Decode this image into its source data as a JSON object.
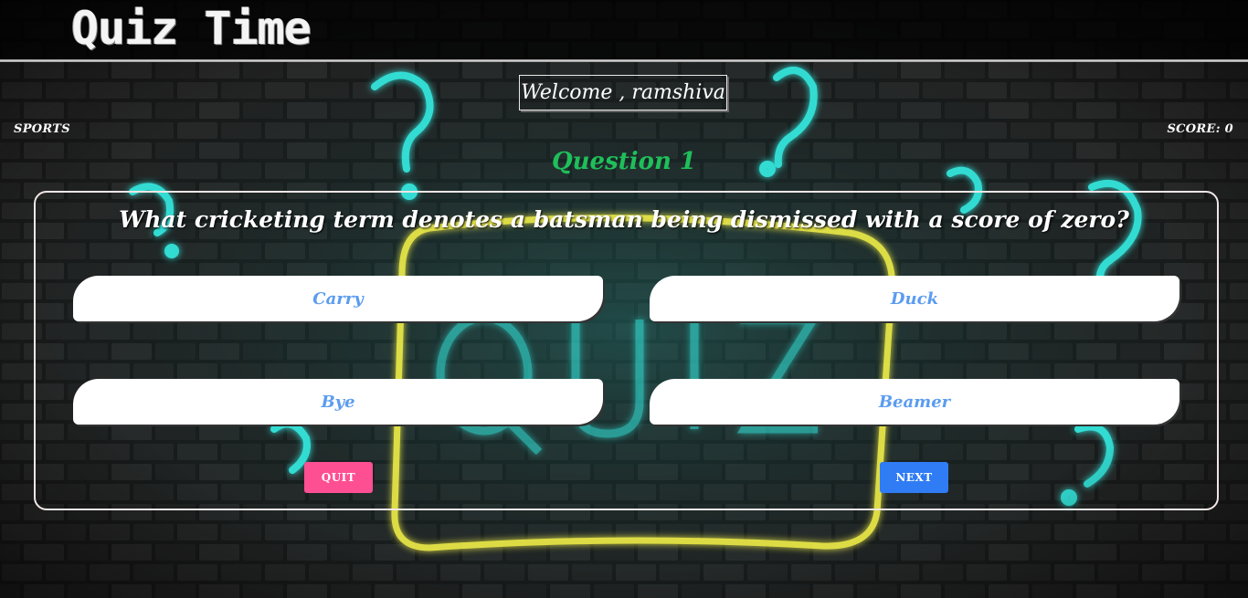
{
  "app": {
    "title": "Quiz Time"
  },
  "welcome": {
    "text": "Welcome , ramshiva"
  },
  "status": {
    "category": "SPORTS",
    "score_label": "SCORE: 0"
  },
  "quiz": {
    "question_number": "Question 1",
    "question": "What cricketing term denotes a batsman being dismissed with a score of zero?",
    "options": [
      {
        "label": "Carry"
      },
      {
        "label": "Duck"
      },
      {
        "label": "Bye"
      },
      {
        "label": "Beamer"
      }
    ]
  },
  "actions": {
    "quit_label": "QUIT",
    "next_label": "NEXT"
  },
  "colors": {
    "question_number": "#1fbf5a",
    "option_text": "#5b9cf0",
    "quit_button": "#ff4f93",
    "next_button": "#2f7cf5",
    "neon_cyan": "#35f0e6",
    "neon_yellow": "#f2f04a"
  },
  "background": {
    "neon_sign_text": "QUIZ"
  }
}
